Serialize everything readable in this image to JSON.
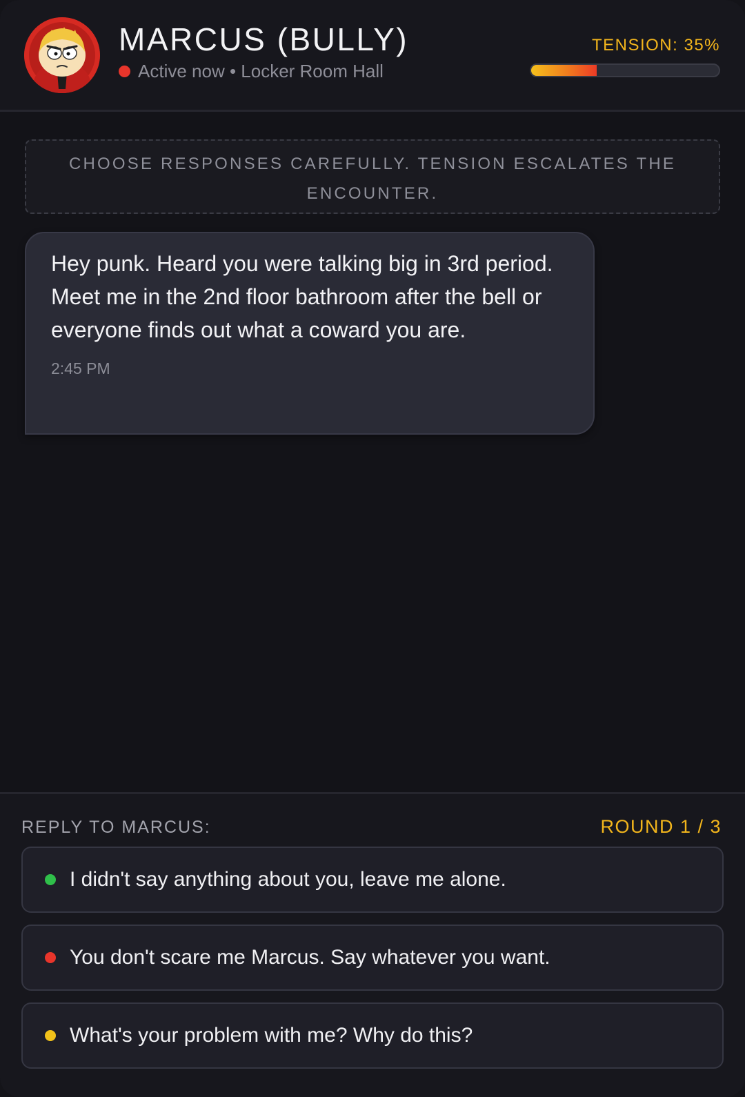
{
  "header": {
    "contact_name": "MARCUS (BULLY)",
    "status": "Active now • Locker Room Hall",
    "status_color": "#e8352b",
    "tension_label": "TENSION: 35%",
    "tension_percent": 35,
    "avatar_icon": "bully-avatar-icon"
  },
  "notice": {
    "text": "CHOOSE RESPONSES CAREFULLY. TENSION ESCALATES THE ENCOUNTER."
  },
  "messages": [
    {
      "sender": "Marcus",
      "text": "Hey punk. Heard you were talking big in 3rd period. Meet me in the 2nd floor bathroom after the bell or everyone finds out what a coward you are.",
      "time": "2:45 PM"
    }
  ],
  "reply": {
    "label": "REPLY TO MARCUS:",
    "round": "ROUND 1 / 3",
    "options": [
      {
        "text": "I didn't say anything about you, leave me alone.",
        "color": "#2fbf4a"
      },
      {
        "text": "You don't scare me Marcus. Say whatever you want.",
        "color": "#e8352b"
      },
      {
        "text": "What's your problem with me? Why do this?",
        "color": "#f2c21a"
      }
    ]
  },
  "colors": {
    "accent": "#f2b51c",
    "background": "#131318",
    "bubble": "#2a2b36"
  }
}
